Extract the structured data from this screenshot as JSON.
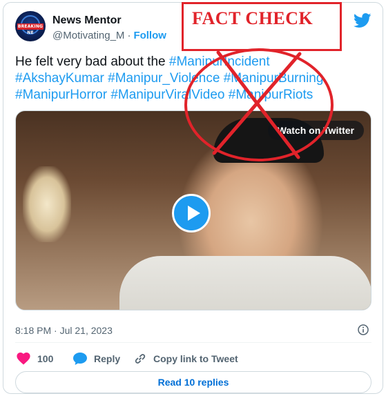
{
  "tweet": {
    "author_name": "News Mentor",
    "handle": "@Motivating_M",
    "separator": "·",
    "follow_label": "Follow",
    "avatar_badge": "BREAKING NE",
    "text_plain": "He felt very bad about the ",
    "hashtags": [
      "#ManipurIncident",
      "#AkshayKumar",
      "#Manipur_Violence",
      "#ManipurBurning",
      "#ManipurHorror",
      "#ManipurViralVideo",
      "#ManipurRiots"
    ],
    "timestamp": "8:18 PM · Jul 21, 2023",
    "media": {
      "watch_label": "Watch on Twitter"
    },
    "actions": {
      "like_count": "100",
      "reply_label": "Reply",
      "copy_label": "Copy link to Tweet"
    },
    "read_replies_label": "Read 10 replies"
  },
  "overlay": {
    "stamp_text": "FACT CHECK",
    "stamp_color": "#e1232a"
  },
  "colors": {
    "link": "#1d9bf0",
    "muted": "#536471",
    "like": "#f91880"
  }
}
